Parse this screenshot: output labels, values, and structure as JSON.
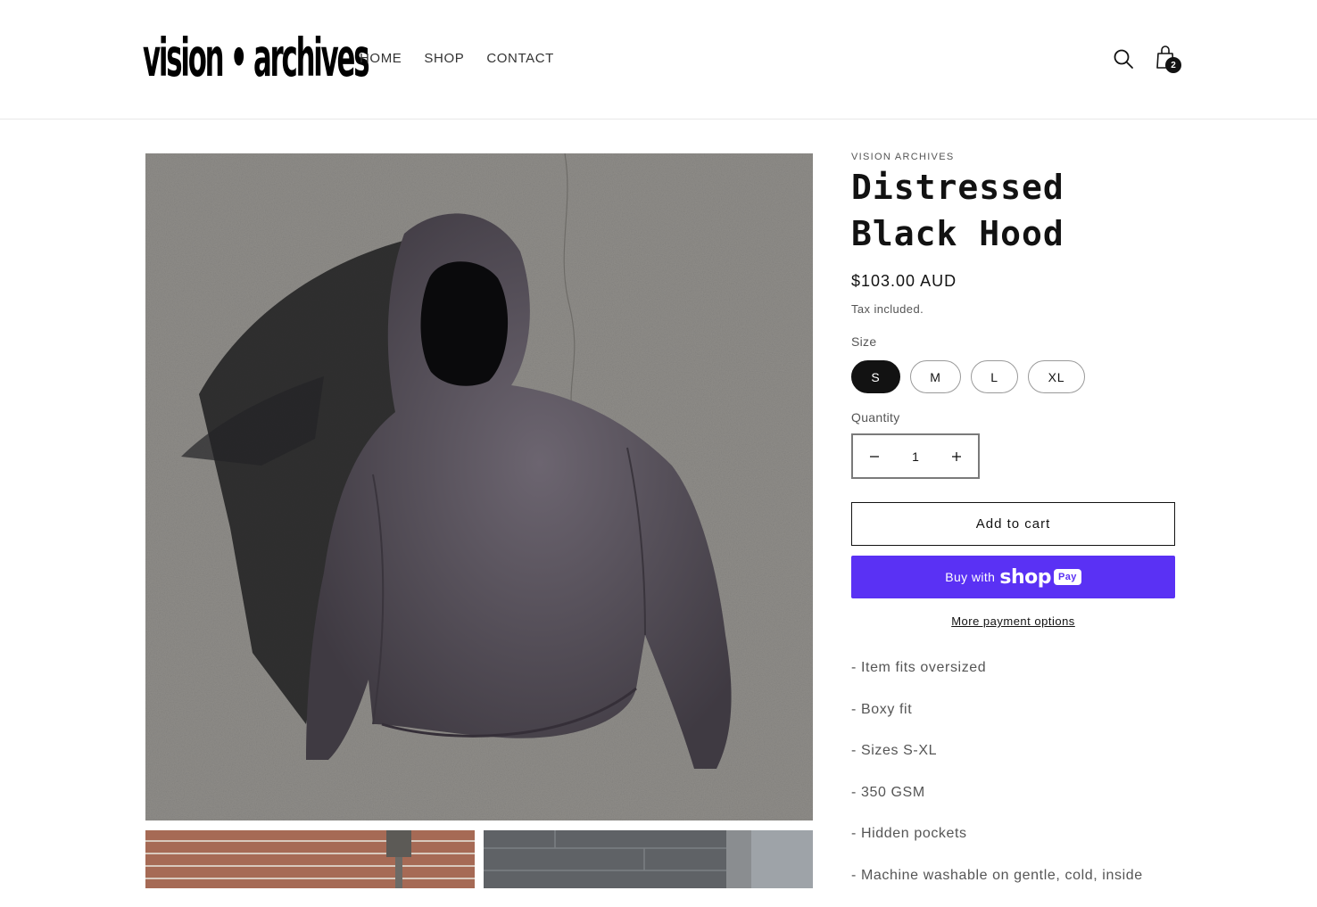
{
  "header": {
    "logo_text": "vision • archives",
    "nav": [
      "HOME",
      "SHOP",
      "CONTACT"
    ],
    "cart_count": "2",
    "icons": [
      "search-icon",
      "cart-icon"
    ]
  },
  "product": {
    "vendor": "VISION ARCHIVES",
    "title": "Distressed Black Hood",
    "price": "$103.00 AUD",
    "tax_note": "Tax included.",
    "size_label": "Size",
    "sizes": [
      "S",
      "M",
      "L",
      "XL"
    ],
    "selected_size": "S",
    "quantity_label": "Quantity",
    "quantity": "1",
    "add_to_cart": "Add to cart",
    "buy_with": "Buy with",
    "shop_word": "shop",
    "pay_word": "Pay",
    "more_payment": "More payment options",
    "description": [
      "- Item fits oversized",
      "- Boxy fit",
      "- Sizes S-XL",
      "- 350 GSM",
      "- Hidden pockets",
      "- Machine washable on gentle, cold, inside"
    ]
  },
  "colors": {
    "accent_shop": "#5a31f4",
    "selected_pill": "#121212",
    "text": "#121212",
    "muted_text": "#555555"
  }
}
